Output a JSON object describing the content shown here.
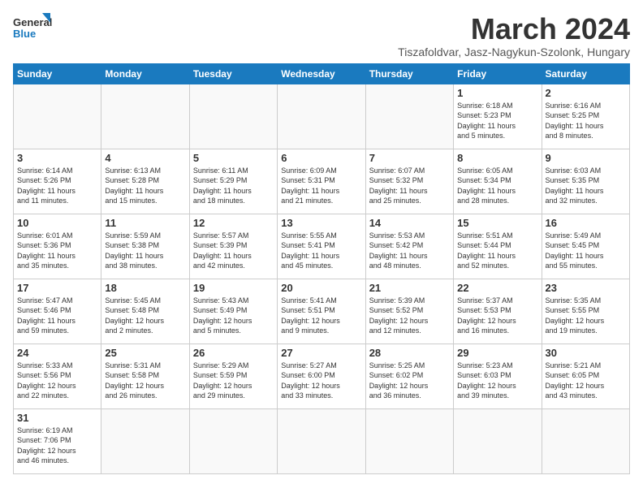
{
  "header": {
    "logo_general": "General",
    "logo_blue": "Blue",
    "month_title": "March 2024",
    "subtitle": "Tiszafoldvar, Jasz-Nagykun-Szolonk, Hungary"
  },
  "days_of_week": [
    "Sunday",
    "Monday",
    "Tuesday",
    "Wednesday",
    "Thursday",
    "Friday",
    "Saturday"
  ],
  "weeks": [
    [
      {
        "day": "",
        "info": ""
      },
      {
        "day": "",
        "info": ""
      },
      {
        "day": "",
        "info": ""
      },
      {
        "day": "",
        "info": ""
      },
      {
        "day": "",
        "info": ""
      },
      {
        "day": "1",
        "info": "Sunrise: 6:18 AM\nSunset: 5:23 PM\nDaylight: 11 hours\nand 5 minutes."
      },
      {
        "day": "2",
        "info": "Sunrise: 6:16 AM\nSunset: 5:25 PM\nDaylight: 11 hours\nand 8 minutes."
      }
    ],
    [
      {
        "day": "3",
        "info": "Sunrise: 6:14 AM\nSunset: 5:26 PM\nDaylight: 11 hours\nand 11 minutes."
      },
      {
        "day": "4",
        "info": "Sunrise: 6:13 AM\nSunset: 5:28 PM\nDaylight: 11 hours\nand 15 minutes."
      },
      {
        "day": "5",
        "info": "Sunrise: 6:11 AM\nSunset: 5:29 PM\nDaylight: 11 hours\nand 18 minutes."
      },
      {
        "day": "6",
        "info": "Sunrise: 6:09 AM\nSunset: 5:31 PM\nDaylight: 11 hours\nand 21 minutes."
      },
      {
        "day": "7",
        "info": "Sunrise: 6:07 AM\nSunset: 5:32 PM\nDaylight: 11 hours\nand 25 minutes."
      },
      {
        "day": "8",
        "info": "Sunrise: 6:05 AM\nSunset: 5:34 PM\nDaylight: 11 hours\nand 28 minutes."
      },
      {
        "day": "9",
        "info": "Sunrise: 6:03 AM\nSunset: 5:35 PM\nDaylight: 11 hours\nand 32 minutes."
      }
    ],
    [
      {
        "day": "10",
        "info": "Sunrise: 6:01 AM\nSunset: 5:36 PM\nDaylight: 11 hours\nand 35 minutes."
      },
      {
        "day": "11",
        "info": "Sunrise: 5:59 AM\nSunset: 5:38 PM\nDaylight: 11 hours\nand 38 minutes."
      },
      {
        "day": "12",
        "info": "Sunrise: 5:57 AM\nSunset: 5:39 PM\nDaylight: 11 hours\nand 42 minutes."
      },
      {
        "day": "13",
        "info": "Sunrise: 5:55 AM\nSunset: 5:41 PM\nDaylight: 11 hours\nand 45 minutes."
      },
      {
        "day": "14",
        "info": "Sunrise: 5:53 AM\nSunset: 5:42 PM\nDaylight: 11 hours\nand 48 minutes."
      },
      {
        "day": "15",
        "info": "Sunrise: 5:51 AM\nSunset: 5:44 PM\nDaylight: 11 hours\nand 52 minutes."
      },
      {
        "day": "16",
        "info": "Sunrise: 5:49 AM\nSunset: 5:45 PM\nDaylight: 11 hours\nand 55 minutes."
      }
    ],
    [
      {
        "day": "17",
        "info": "Sunrise: 5:47 AM\nSunset: 5:46 PM\nDaylight: 11 hours\nand 59 minutes."
      },
      {
        "day": "18",
        "info": "Sunrise: 5:45 AM\nSunset: 5:48 PM\nDaylight: 12 hours\nand 2 minutes."
      },
      {
        "day": "19",
        "info": "Sunrise: 5:43 AM\nSunset: 5:49 PM\nDaylight: 12 hours\nand 5 minutes."
      },
      {
        "day": "20",
        "info": "Sunrise: 5:41 AM\nSunset: 5:51 PM\nDaylight: 12 hours\nand 9 minutes."
      },
      {
        "day": "21",
        "info": "Sunrise: 5:39 AM\nSunset: 5:52 PM\nDaylight: 12 hours\nand 12 minutes."
      },
      {
        "day": "22",
        "info": "Sunrise: 5:37 AM\nSunset: 5:53 PM\nDaylight: 12 hours\nand 16 minutes."
      },
      {
        "day": "23",
        "info": "Sunrise: 5:35 AM\nSunset: 5:55 PM\nDaylight: 12 hours\nand 19 minutes."
      }
    ],
    [
      {
        "day": "24",
        "info": "Sunrise: 5:33 AM\nSunset: 5:56 PM\nDaylight: 12 hours\nand 22 minutes."
      },
      {
        "day": "25",
        "info": "Sunrise: 5:31 AM\nSunset: 5:58 PM\nDaylight: 12 hours\nand 26 minutes."
      },
      {
        "day": "26",
        "info": "Sunrise: 5:29 AM\nSunset: 5:59 PM\nDaylight: 12 hours\nand 29 minutes."
      },
      {
        "day": "27",
        "info": "Sunrise: 5:27 AM\nSunset: 6:00 PM\nDaylight: 12 hours\nand 33 minutes."
      },
      {
        "day": "28",
        "info": "Sunrise: 5:25 AM\nSunset: 6:02 PM\nDaylight: 12 hours\nand 36 minutes."
      },
      {
        "day": "29",
        "info": "Sunrise: 5:23 AM\nSunset: 6:03 PM\nDaylight: 12 hours\nand 39 minutes."
      },
      {
        "day": "30",
        "info": "Sunrise: 5:21 AM\nSunset: 6:05 PM\nDaylight: 12 hours\nand 43 minutes."
      }
    ],
    [
      {
        "day": "31",
        "info": "Sunrise: 6:19 AM\nSunset: 7:06 PM\nDaylight: 12 hours\nand 46 minutes."
      },
      {
        "day": "",
        "info": ""
      },
      {
        "day": "",
        "info": ""
      },
      {
        "day": "",
        "info": ""
      },
      {
        "day": "",
        "info": ""
      },
      {
        "day": "",
        "info": ""
      },
      {
        "day": "",
        "info": ""
      }
    ]
  ]
}
